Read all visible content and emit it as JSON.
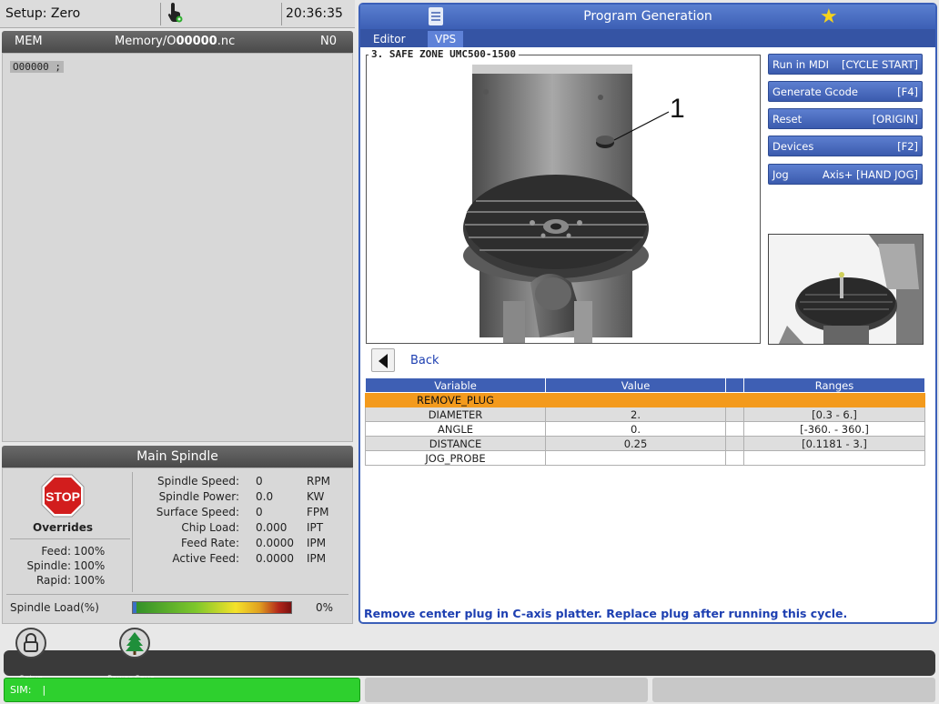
{
  "topbar": {
    "mode": "Setup: Zero",
    "time": "20:36:35"
  },
  "memory": {
    "device": "MEM",
    "path_prefix": "Memory/O",
    "path_number": "00000",
    "path_ext": ".nc",
    "line": "N0",
    "program_line": "O00000 ;"
  },
  "spindle": {
    "title": "Main Spindle",
    "stop_label": "STOP",
    "overrides_title": "Overrides",
    "overrides": [
      {
        "label": "Feed:",
        "value": "100%"
      },
      {
        "label": "Spindle:",
        "value": "100%"
      },
      {
        "label": "Rapid:",
        "value": "100%"
      }
    ],
    "readouts": [
      {
        "label": "Spindle Speed:",
        "value": "0",
        "unit": "RPM"
      },
      {
        "label": "Spindle Power:",
        "value": "0.0",
        "unit": "KW"
      },
      {
        "label": "Surface Speed:",
        "value": "0",
        "unit": "FPM"
      },
      {
        "label": "Chip Load:",
        "value": "0.000",
        "unit": "IPT"
      },
      {
        "label": "Feed Rate:",
        "value": "0.0000",
        "unit": "IPM"
      },
      {
        "label": "Active Feed:",
        "value": "0.0000",
        "unit": "IPM"
      }
    ],
    "load_label": "Spindle Load(%)",
    "load_value": "0%",
    "load_fraction": 0.0
  },
  "program_generation": {
    "title": "Program Generation",
    "tabs": [
      {
        "label": "Editor"
      },
      {
        "label": "VPS"
      }
    ],
    "image_caption": "3. SAFE ZONE UMC500-1500",
    "callout": "1",
    "buttons": [
      {
        "left": "Run in MDI",
        "right": "[CYCLE START]"
      },
      {
        "left": "Generate Gcode",
        "right": "[F4]"
      },
      {
        "left": "Reset",
        "right": "[ORIGIN]"
      },
      {
        "left": "Devices",
        "right": "[F2]"
      },
      {
        "left": "Jog",
        "right": "Axis+ [HAND JOG]"
      }
    ],
    "back_label": "Back",
    "table": {
      "headers": [
        "Variable",
        "Value",
        "",
        "Ranges"
      ],
      "rows": [
        [
          "REMOVE_PLUG",
          "",
          "",
          ""
        ],
        [
          "DIAMETER",
          "2.",
          "",
          "[0.3 - 6.]"
        ],
        [
          "ANGLE",
          "0.",
          "",
          "[-360. - 360.]"
        ],
        [
          "DISTANCE",
          "0.25",
          "",
          "[0.1181 - 3.]"
        ],
        [
          "JOG_PROBE",
          "",
          "",
          ""
        ]
      ]
    },
    "note": "Remove center plug in C-axis platter. Replace plug after running this cycle."
  },
  "dock": {
    "setup_label": "Setup",
    "power_label": "Power Save"
  },
  "status": {
    "sim": "SIM:"
  },
  "colors": {
    "accent": "#3c5fb5",
    "selected_row": "#f39a1d",
    "sim_bar": "#2ed02e"
  }
}
